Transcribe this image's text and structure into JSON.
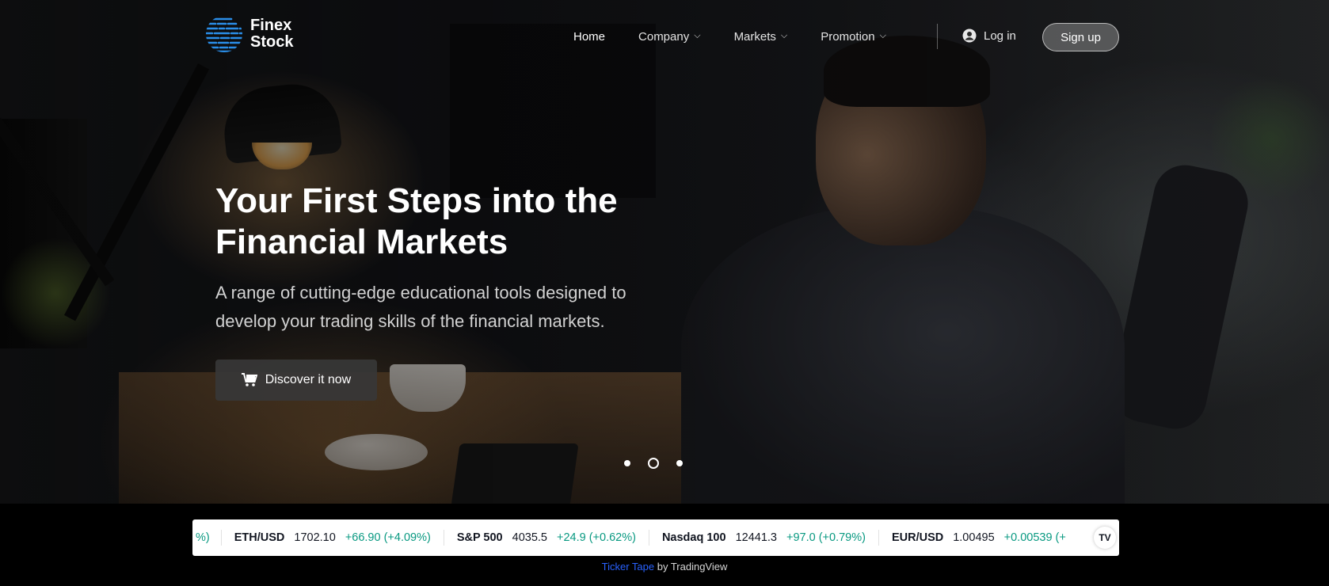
{
  "brand": {
    "line1": "Finex",
    "line2": "Stock"
  },
  "nav": {
    "items": [
      {
        "label": "Home",
        "active": true,
        "dropdown": false
      },
      {
        "label": "Company",
        "dropdown": true
      },
      {
        "label": "Markets",
        "dropdown": true
      },
      {
        "label": "Promotion",
        "dropdown": true
      }
    ],
    "login_label": "Log in",
    "signup_label": "Sign up"
  },
  "hero": {
    "headline_line1": "Your First Steps into the",
    "headline_line2": "Financial Markets",
    "subtext_line1": "A range of cutting-edge educational tools designed to",
    "subtext_line2": "develop your trading skills of the financial markets.",
    "cta_label": "Discover it now",
    "slides": {
      "count": 3,
      "active_index": 1
    }
  },
  "ticker": {
    "leading_fragment": "%)",
    "items": [
      {
        "symbol": "ETH/USD",
        "price": "1702.10",
        "change": "+66.90 (+4.09%)"
      },
      {
        "symbol": "S&P 500",
        "price": "4035.5",
        "change": "+24.9 (+0.62%)"
      },
      {
        "symbol": "Nasdaq 100",
        "price": "12441.3",
        "change": "+97.0 (+0.79%)"
      },
      {
        "symbol": "EUR/USD",
        "price": "1.00495",
        "change": "+0.00539 (+"
      }
    ],
    "badge": "TV",
    "attribution_link": "Ticker Tape",
    "attribution_suffix": " by TradingView"
  },
  "colors": {
    "ticker_positive": "#089981",
    "attribution_link": "#2962ff",
    "logo_blue": "#2a8ee8"
  }
}
